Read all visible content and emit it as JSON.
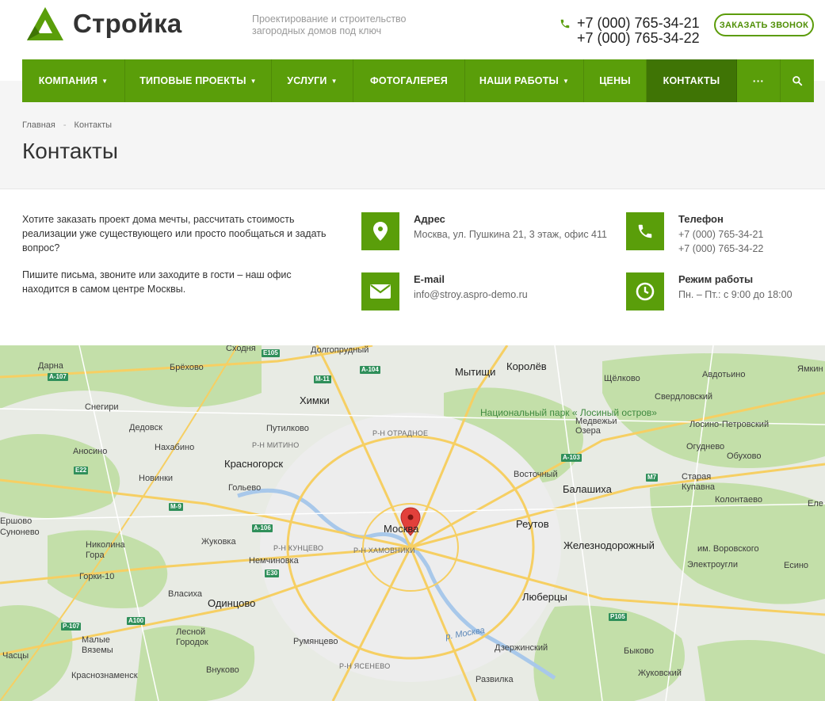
{
  "header": {
    "logo_text": "Стройка",
    "tagline_line1": "Проектирование и строительство",
    "tagline_line2": "загородных домов под ключ",
    "phone1": "+7 (000) 765-34-21",
    "phone2": "+7 (000) 765-34-22",
    "callback_label": "ЗАКАЗАТЬ ЗВОНОК",
    "brand_color": "#5a9e0a"
  },
  "nav": {
    "items": [
      {
        "label": "КОМПАНИЯ",
        "chevron": true
      },
      {
        "label": "ТИПОВЫЕ ПРОЕКТЫ",
        "chevron": true
      },
      {
        "label": "УСЛУГИ",
        "chevron": true
      },
      {
        "label": "ФОТОГАЛЕРЕЯ",
        "chevron": false
      },
      {
        "label": "НАШИ РАБОТЫ",
        "chevron": true
      },
      {
        "label": "ЦЕНЫ",
        "chevron": false
      },
      {
        "label": "КОНТАКТЫ",
        "chevron": false,
        "active": true
      }
    ],
    "more_label": "···"
  },
  "breadcrumb": {
    "home": "Главная",
    "separator": "-",
    "current": "Контакты"
  },
  "page": {
    "title": "Контакты"
  },
  "intro": {
    "p1": "Хотите заказать проект дома мечты, рассчитать стоимость реализации уже существующего или просто пообщаться и задать вопрос?",
    "p2": "Пишите письма, звоните или заходите в гости – наш офис находится в самом центре Москвы."
  },
  "contacts": {
    "address": {
      "title": "Адрес",
      "value": "Москва, ул. Пушкина 21, 3 этаж, офис 411",
      "icon": "map-pin-icon"
    },
    "phone": {
      "title": "Телефон",
      "value1": "+7 (000) 765-34-21",
      "value2": "+7 (000) 765-34-22",
      "icon": "phone-icon"
    },
    "email": {
      "title": "E-mail",
      "value": "info@stroy.aspro-demo.ru",
      "icon": "envelope-icon"
    },
    "hours": {
      "title": "Режим работы",
      "value": "Пн. – Пт.: с 9:00 до 18:00",
      "icon": "clock-icon"
    }
  },
  "map": {
    "center_label": "Москва",
    "places": [
      "Сходня",
      "Долгопрудный",
      "Дарна",
      "Брёхово",
      "Мытищи",
      "Королёв",
      "Щёлково",
      "Авдотьино",
      "Химки",
      "Свердловский",
      "Снегири",
      "Дедовск",
      "Путилково",
      "Р-Н МИТИНО",
      "Р-Н ОТРАДНОЕ",
      "Национальный парк « Лосиный остров»",
      "Медвежьи Озера",
      "Лосино-Петровский",
      "Аносино",
      "Нахабино",
      "Красногорск",
      "Огуднево",
      "Обухово",
      "Новинки",
      "Гольево",
      "Восточный",
      "Балашиха",
      "Старая Купавна",
      "Колонтаево",
      "Ершово",
      "Сунонево",
      "Жуковка",
      "Реутов",
      "Р-Н КУНЦЕВО",
      "Р-Н ХАМОВНИКИ",
      "Железнодорожный",
      "Николина Гора",
      "Немчиновка",
      "им. Воровского",
      "Горки-10",
      "Электроугли",
      "Есино",
      "Власиха",
      "Одинцово",
      "Люберцы",
      "Лесной Городок",
      "Румянцево",
      "Малые Вяземы",
      "Часцы",
      "Дзержинский",
      "Быково",
      "Краснознаменск",
      "Внуково",
      "Р-Н ЯСЕНЕВО",
      "Развилка",
      "Жуковский",
      "Ямкин",
      "Еле"
    ],
    "roads": [
      "E105",
      "A-104",
      "M-11",
      "A-107",
      "A-103",
      "E22",
      "M7",
      "M-9",
      "A-106",
      "E30",
      "A100",
      "P105",
      "P-107"
    ],
    "river_label": "р. Москва"
  }
}
